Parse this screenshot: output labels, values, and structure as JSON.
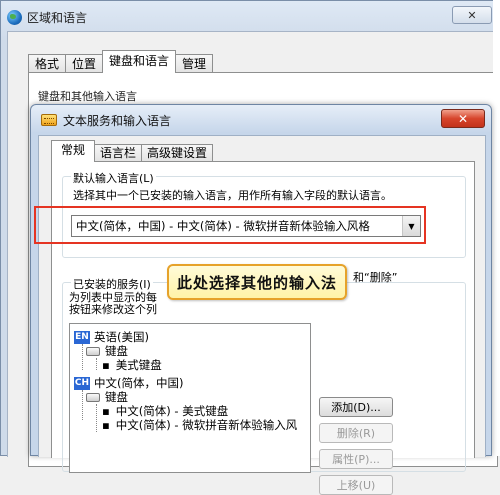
{
  "outer_window": {
    "title": "区域和语言",
    "close_label": "✕",
    "tabs": [
      "格式",
      "位置",
      "键盘和语言",
      "管理"
    ],
    "active_tab": "键盘和语言",
    "group_label": "键盘和其他输入语言"
  },
  "dialog": {
    "title": "文本服务和输入语言",
    "close_label": "✕",
    "tabs": [
      "常规",
      "语言栏",
      "高级键设置"
    ],
    "active_tab": "常规",
    "default_language": {
      "group_title": "默认输入语言(L)",
      "description": "选择其中一个已安装的输入语言，用作所有输入字段的默认语言。",
      "selected_value": "中文(简体，中国) - 中文(简体) - 微软拼音新体验输入风格"
    },
    "installed_services": {
      "group_title": "已安装的服务(I)",
      "description_line1": "为列表中显示的每",
      "description_line2": "按钮来修改这个列",
      "description_tail": "和“删除”",
      "tree": [
        {
          "badge": "EN",
          "label": "英语(美国)"
        },
        {
          "label": "键盘"
        },
        {
          "label": "美式键盘"
        },
        {
          "badge": "CH",
          "label": "中文(简体，中国)"
        },
        {
          "label": "键盘"
        },
        {
          "label": "中文(简体) - 美式键盘"
        },
        {
          "label": "中文(简体) - 微软拼音新体验输入风"
        }
      ],
      "buttons": {
        "add": "添加(D)...",
        "remove": "删除(R)",
        "properties": "属性(P)...",
        "move_up": "上移(U)"
      }
    }
  },
  "callout": {
    "text": "此处选择其他的输入法"
  },
  "colors": {
    "highlight_red": "#e53422",
    "callout_border": "#e6a22a",
    "lang_badge": "#2a67d4"
  }
}
